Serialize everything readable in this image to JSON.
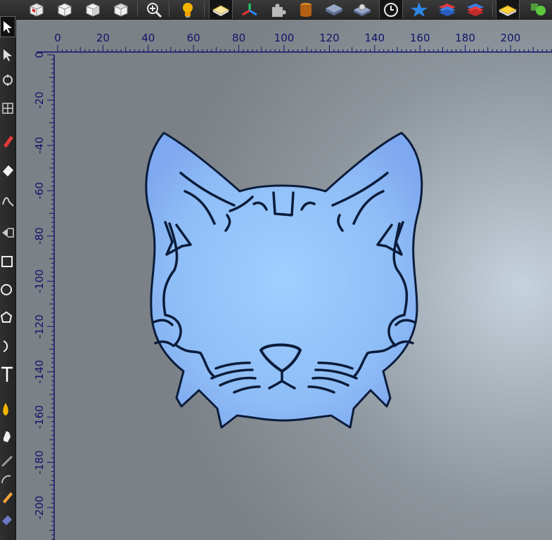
{
  "toolbar": {
    "buttons": [
      {
        "name": "view-cube-icon",
        "tip": "3D view"
      },
      {
        "name": "front-view-icon",
        "tip": "Front view"
      },
      {
        "name": "side-view-icon",
        "tip": "Side view"
      },
      {
        "name": "top-view-icon",
        "tip": "Top view"
      },
      {
        "name": "zoom-in-icon",
        "tip": "Zoom"
      },
      {
        "name": "light-bulb-icon",
        "tip": "Lighting"
      },
      {
        "name": "flat-layer-icon",
        "tip": "Layer"
      },
      {
        "name": "axes-icon",
        "tip": "Axes"
      },
      {
        "name": "puzzle-icon",
        "tip": "Plugins"
      },
      {
        "name": "cylinder-icon",
        "tip": "Material"
      },
      {
        "name": "stack-slab-icon",
        "tip": "Stack"
      },
      {
        "name": "stack-gear-icon",
        "tip": "Stack settings"
      },
      {
        "name": "clock-icon",
        "tip": "History"
      },
      {
        "name": "star-icon",
        "tip": "Favorites"
      },
      {
        "name": "layers-blue-icon",
        "tip": "Layers"
      },
      {
        "name": "layers-red-icon",
        "tip": "Layers active"
      },
      {
        "name": "yellow-slab-icon",
        "tip": "Output"
      },
      {
        "name": "green-shapes-icon",
        "tip": "Shapes"
      }
    ]
  },
  "side_tools": [
    {
      "name": "select-arrow-icon"
    },
    {
      "name": "node-edit-icon"
    },
    {
      "name": "transform-icon"
    },
    {
      "name": "warp-grid-icon"
    },
    {
      "name": "pen-tool-icon"
    },
    {
      "name": "eraser-icon"
    },
    {
      "name": "smooth-tool-icon"
    },
    {
      "name": "crop-arrow-icon"
    },
    {
      "name": "rectangle-icon"
    },
    {
      "name": "ellipse-icon"
    },
    {
      "name": "polygon-icon"
    },
    {
      "name": "arc-icon"
    },
    {
      "name": "text-tool-icon"
    },
    {
      "name": "fill-bucket-icon"
    },
    {
      "name": "hand-pan-icon"
    },
    {
      "name": "measure-line-icon"
    },
    {
      "name": "arc-measure-icon"
    },
    {
      "name": "pencil-icon"
    },
    {
      "name": "sculpt-block-icon"
    }
  ],
  "ruler": {
    "x_labels": [
      "0",
      "20",
      "40",
      "60",
      "80",
      "100",
      "120",
      "140",
      "160",
      "180",
      "200"
    ],
    "y_labels": [
      "0",
      "-20",
      "-40",
      "-60",
      "-80",
      "-100",
      "-120",
      "-140",
      "-160",
      "-180",
      "-200"
    ]
  },
  "colors": {
    "ruler": "#13136b",
    "shape_fill": "#8fbdf6",
    "shape_outline": "#0b1c3a"
  }
}
